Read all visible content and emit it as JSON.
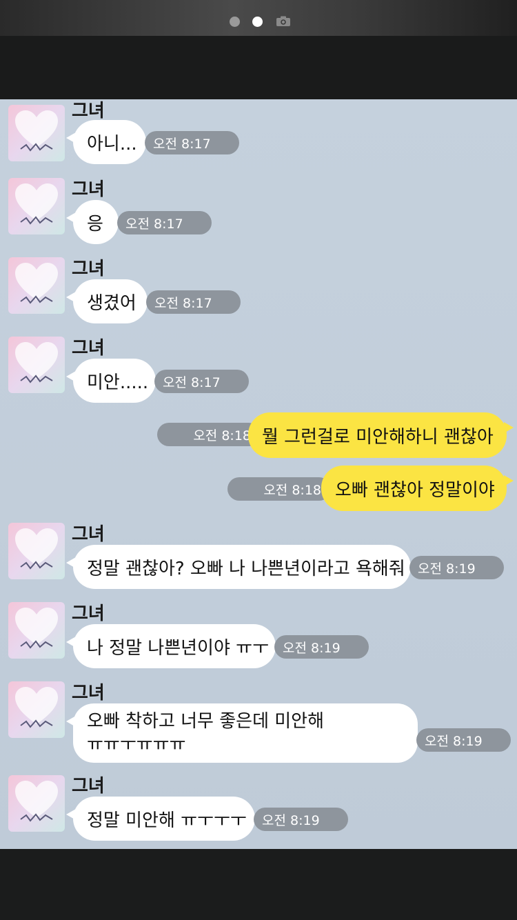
{
  "status_bar": {
    "page_dots": [
      {
        "state": "inactive"
      },
      {
        "state": "active"
      }
    ],
    "camera_icon": "camera-icon"
  },
  "chat": {
    "sender_name": "그녀",
    "messages": [
      {
        "direction": "in",
        "text": "아니...",
        "time": "오전 8:17"
      },
      {
        "direction": "in",
        "text": "응",
        "time": "오전 8:17"
      },
      {
        "direction": "in",
        "text": "생겼어",
        "time": "오전 8:17"
      },
      {
        "direction": "in",
        "text": "미안.....",
        "time": "오전 8:17"
      },
      {
        "direction": "out",
        "text": "뭘 그런걸로 미안해하니 괜찮아",
        "time": "오전 8:18"
      },
      {
        "direction": "out",
        "text": "오빠 괜찮아 정말이야",
        "time": "오전 8:18"
      },
      {
        "direction": "in",
        "text": "정말 괜찮아? 오빠 나 나쁜년이라고 욕해줘",
        "time": "오전 8:19"
      },
      {
        "direction": "in",
        "text": "나 정말 나쁜년이야 ㅠㅜ",
        "time": "오전 8:19"
      },
      {
        "direction": "in",
        "lines": [
          "오빠 착하고 너무 좋은데 미안해",
          "ㅠㅠㅜㅠㅠㅠ"
        ],
        "time": "오전 8:19"
      },
      {
        "direction": "in",
        "text": "정말 미안해 ㅠㅜㅜㅜ",
        "time": "오전 8:19"
      }
    ]
  },
  "colors": {
    "chat_background": "#c2cedb",
    "incoming_bubble": "#ffffff",
    "outgoing_bubble": "#fbe443",
    "timestamp_pill": "#8e959d"
  }
}
